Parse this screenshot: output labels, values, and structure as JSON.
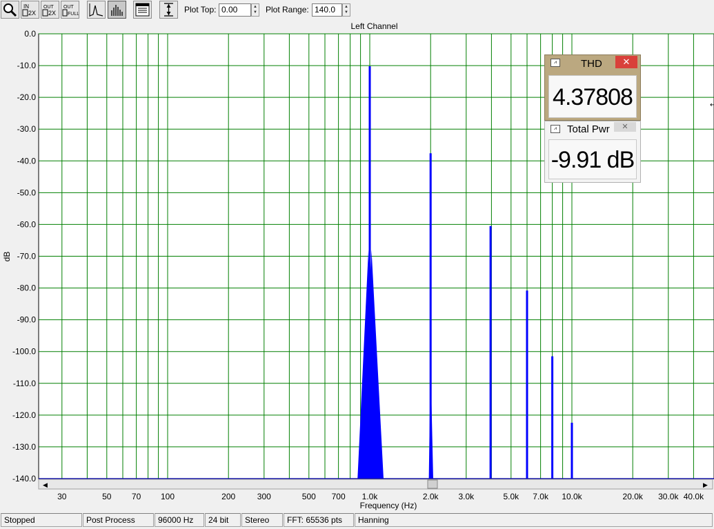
{
  "toolbar": {
    "buttons": [
      {
        "name": "zoom-tool",
        "icon": "magnifier-icon"
      },
      {
        "name": "zoom-in-2x",
        "icon": "zoom-in-2x-icon",
        "label": "IN 2X"
      },
      {
        "name": "zoom-out-2x",
        "icon": "zoom-out-2x-icon",
        "label": "OUT 2X"
      },
      {
        "name": "zoom-out-full",
        "icon": "zoom-out-full-icon",
        "label": "OUT FULL"
      },
      {
        "name": "line-mode",
        "icon": "line-plot-icon"
      },
      {
        "name": "bar-mode",
        "icon": "bar-plot-icon"
      },
      {
        "name": "plot-settings",
        "icon": "settings-panel-icon"
      },
      {
        "name": "auto-scale",
        "icon": "vertical-range-icon"
      }
    ],
    "plot_top_label": "Plot Top:",
    "plot_top_value": "0.00",
    "plot_range_label": "Plot Range:",
    "plot_range_value": "140.0"
  },
  "chart_data": {
    "type": "bar",
    "title": "Left Channel",
    "xlabel": "Frequency (Hz)",
    "ylabel": "dB",
    "x_scale": "log",
    "xlim": [
      20,
      48000
    ],
    "ylim": [
      -140,
      0
    ],
    "grid": true,
    "yticks": [
      "0.0",
      "-10.0",
      "-20.0",
      "-30.0",
      "-40.0",
      "-50.0",
      "-60.0",
      "-70.0",
      "-80.0",
      "-90.0",
      "-100.0",
      "-110.0",
      "-120.0",
      "-130.0",
      "-140.0"
    ],
    "xticks": [
      {
        "value": 30,
        "label": "30"
      },
      {
        "value": 50,
        "label": "50"
      },
      {
        "value": 70,
        "label": "70"
      },
      {
        "value": 100,
        "label": "100"
      },
      {
        "value": 200,
        "label": "200"
      },
      {
        "value": 300,
        "label": "300"
      },
      {
        "value": 500,
        "label": "500"
      },
      {
        "value": 700,
        "label": "700"
      },
      {
        "value": 1000,
        "label": "1.0k"
      },
      {
        "value": 2000,
        "label": "2.0k"
      },
      {
        "value": 3000,
        "label": "3.0k"
      },
      {
        "value": 5000,
        "label": "5.0k"
      },
      {
        "value": 7000,
        "label": "7.0k"
      },
      {
        "value": 10000,
        "label": "10.0k"
      },
      {
        "value": 20000,
        "label": "20.0k"
      },
      {
        "value": 30000,
        "label": "30.0k"
      },
      {
        "value": 40000,
        "label": "40.0k"
      }
    ],
    "peaks": [
      {
        "freq": 1000,
        "db": -10.2
      },
      {
        "freq": 2000,
        "db": -37.6
      },
      {
        "freq": 3960,
        "db": -60.5
      },
      {
        "freq": 6000,
        "db": -80.8
      },
      {
        "freq": 8000,
        "db": -101.5
      },
      {
        "freq": 10000,
        "db": -122.4
      }
    ],
    "fundamental_skirt": {
      "base_low": 870,
      "base_high": 1170,
      "skirt_top_db": -80,
      "mid_db": -68
    },
    "second_harmonic_skirt": {
      "base_low": 1960,
      "base_high": 2060,
      "skirt_top_db": -110
    },
    "series_color": "#0000ff",
    "grid_color": "#007f00"
  },
  "panels": {
    "thd": {
      "title": "THD",
      "value": "4.37808 %",
      "close": "✕"
    },
    "total_pwr": {
      "title": "Total Pwr",
      "value": "-9.91 dB",
      "close": "✕"
    }
  },
  "statusbar": {
    "state": "Stopped",
    "mode": "Post Process",
    "rate": "96000 Hz",
    "bits": "24 bit",
    "channels": "Stereo",
    "fft": "FFT: 65536 pts",
    "window": "Hanning"
  },
  "colors": {
    "thd_panel_bg": "#bba880",
    "close_red": "#d9403a",
    "grid": "#007f00",
    "spectrum": "#0000ff"
  }
}
